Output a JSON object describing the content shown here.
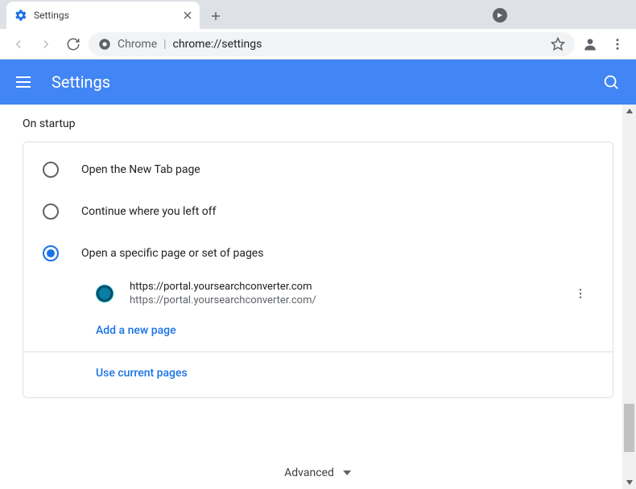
{
  "window": {
    "tab_title": "Settings",
    "addressbar_prefix": "Chrome",
    "addressbar_url": "chrome://settings"
  },
  "header": {
    "title": "Settings"
  },
  "startup": {
    "section_title": "On startup",
    "options": {
      "new_tab": "Open the New Tab page",
      "continue": "Continue where you left off",
      "specific": "Open a specific page or set of pages"
    },
    "pages": [
      {
        "title": "https://portal.yoursearchconverter.com",
        "url": "https://portal.yoursearchconverter.com/"
      }
    ],
    "add_new_page": "Add a new page",
    "use_current": "Use current pages"
  },
  "footer": {
    "advanced": "Advanced"
  }
}
